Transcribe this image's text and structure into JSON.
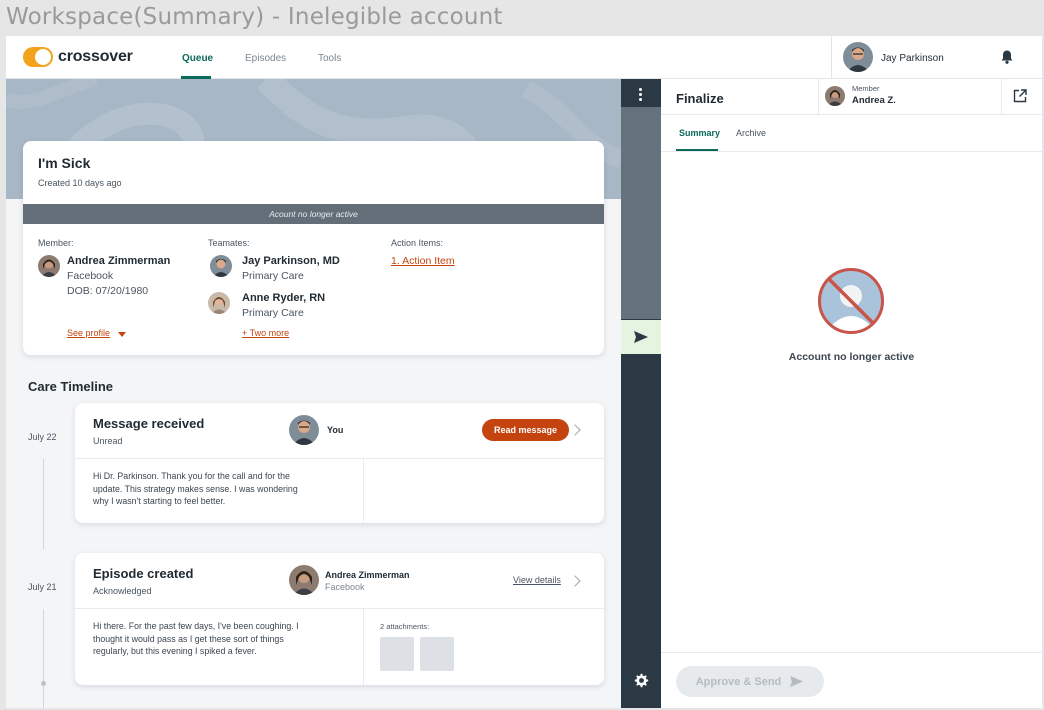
{
  "window": {
    "title": "Workspace(Summary) - Inelegible account"
  },
  "nav": {
    "logo_text": "crossover",
    "tabs": [
      {
        "label": "Queue",
        "active": true
      },
      {
        "label": "Episodes",
        "active": false
      },
      {
        "label": "Tools",
        "active": false
      }
    ],
    "user_name": "Jay Parkinson",
    "icons": {
      "notifications": "bell-icon"
    }
  },
  "episode_card": {
    "title": "I'm Sick",
    "created": "Created 10 days ago",
    "banner": "Acount no longer active",
    "member": {
      "label": "Member:",
      "name": "Andrea Zimmerman",
      "org": "Facebook",
      "dob": "DOB: 07/20/1980",
      "profile_link": "See profile"
    },
    "teammates": {
      "label": "Teamates:",
      "people": [
        {
          "name": "Jay Parkinson, MD",
          "role": "Primary Care"
        },
        {
          "name": "Anne Ryder, RN",
          "role": "Primary Care"
        }
      ],
      "more_link": "+ Two more"
    },
    "action_items": {
      "label": "Action Items:",
      "items": [
        "1. Action Item"
      ]
    }
  },
  "timeline": {
    "title": "Care Timeline",
    "events": [
      {
        "date": "July 22",
        "title": "Message received",
        "status": "Unread",
        "who": "You",
        "who_sub": "",
        "action_label": "Read message",
        "body": "Hi Dr. Parkinson. Thank you for the call and for the update. This strategy makes sense. I was wondering why I wasn't starting to feel better."
      },
      {
        "date": "July 21",
        "title": "Episode created",
        "status": "Acknowledged",
        "who": "Andrea Zimmerman",
        "who_sub": "Facebook",
        "action_label": "View details",
        "body": "Hi there. For the past few days, I've been coughing. I thought it would pass as I get these sort of things regularly, but this evening I spiked a fever.",
        "attachments_label": "2 attachments:"
      }
    ]
  },
  "rail": {
    "icons": [
      "more-vertical-icon",
      "send-icon",
      "gear-icon"
    ]
  },
  "finalize": {
    "title": "Finalize",
    "member_label": "Member",
    "member_name": "Andrea Z.",
    "tabs": [
      {
        "label": "Summary",
        "active": true
      },
      {
        "label": "Archive",
        "active": false
      }
    ],
    "empty_state": "Account no longer active",
    "approve_label": "Approve & Send"
  },
  "colors": {
    "accent_teal": "#0c6a5d",
    "action_orange": "#c5430f",
    "logo_yellow": "#f2a21b",
    "rail_dark": "#2b3944",
    "banner_grey": "#636e78"
  }
}
